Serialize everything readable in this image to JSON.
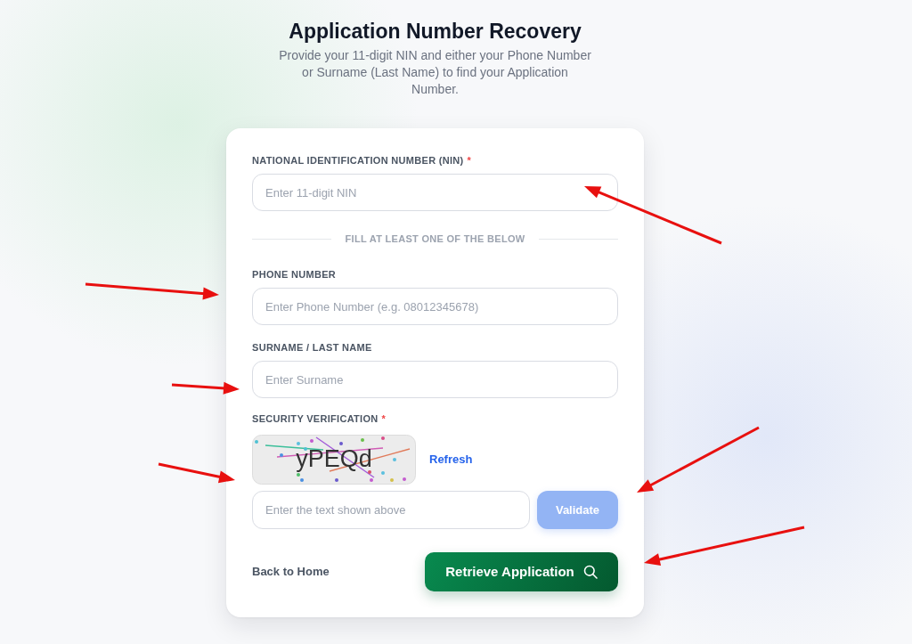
{
  "header": {
    "title": "Application Number Recovery",
    "subtitle": "Provide your 11-digit NIN and either your Phone Number or Surname (Last Name) to find your Application Number."
  },
  "form": {
    "fields": [
      {
        "kind": "input",
        "label": "NATIONAL IDENTIFICATION NUMBER (NIN)",
        "required_mark": "*",
        "placeholder": "Enter 11-digit NIN",
        "annotated": true
      },
      {
        "kind": "divider",
        "label": "FILL AT LEAST ONE OF THE BELOW"
      },
      {
        "kind": "input",
        "label": "PHONE NUMBER",
        "placeholder": "Enter Phone Number (e.g. 08012345678)",
        "annotated": true
      },
      {
        "kind": "input",
        "label": "SURNAME / LAST NAME",
        "placeholder": "Enter Surname",
        "annotated": true
      }
    ],
    "security": {
      "label": "SECURITY VERIFICATION",
      "required_mark": "*",
      "captcha_text": "yPEQd",
      "refresh_link": "Refresh",
      "placeholder": "Enter the text shown above",
      "annotated": true,
      "validate_button": {
        "label": "Validate",
        "disabled": true,
        "annotated": true
      }
    },
    "actions": {
      "back_link": "Back to Home",
      "submit_button": {
        "label": "Retrieve Application",
        "annotated": true
      }
    }
  }
}
